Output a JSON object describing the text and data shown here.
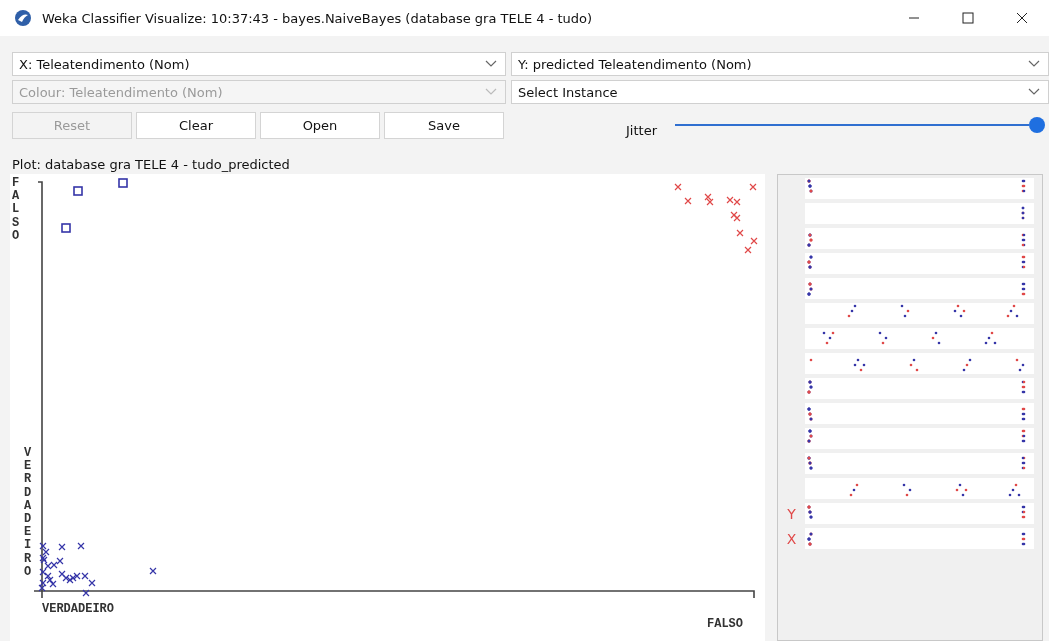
{
  "window": {
    "title": "Weka Classifier Visualize: 10:37:43 - bayes.NaiveBayes (database gra TELE 4 - tudo)"
  },
  "x_select": {
    "value": "X: Teleatendimento (Nom)",
    "disabled": false
  },
  "y_select": {
    "value": "Y: predicted Teleatendimento (Nom)",
    "disabled": false
  },
  "colour_select": {
    "value": "Colour: Teleatendimento (Nom)",
    "disabled": true
  },
  "instance_select": {
    "value": "Select Instance",
    "disabled": false
  },
  "buttons": [
    {
      "label": "Reset",
      "disabled": true
    },
    {
      "label": "Clear",
      "disabled": false
    },
    {
      "label": "Open",
      "disabled": false
    },
    {
      "label": "Save",
      "disabled": false
    }
  ],
  "jitter": {
    "label": "Jitter",
    "level": 1
  },
  "plot": {
    "title": "Plot: database gra TELE 4 - tudo_predicted",
    "y_top_label": "FALSO",
    "y_bottom_label": "VERDADEIRO",
    "x_left_label": "VERDADEIRO",
    "x_right_label": "FALSO"
  },
  "attribute_panel": {
    "markers": [
      {
        "text": "Y"
      },
      {
        "text": "X"
      }
    ]
  }
}
